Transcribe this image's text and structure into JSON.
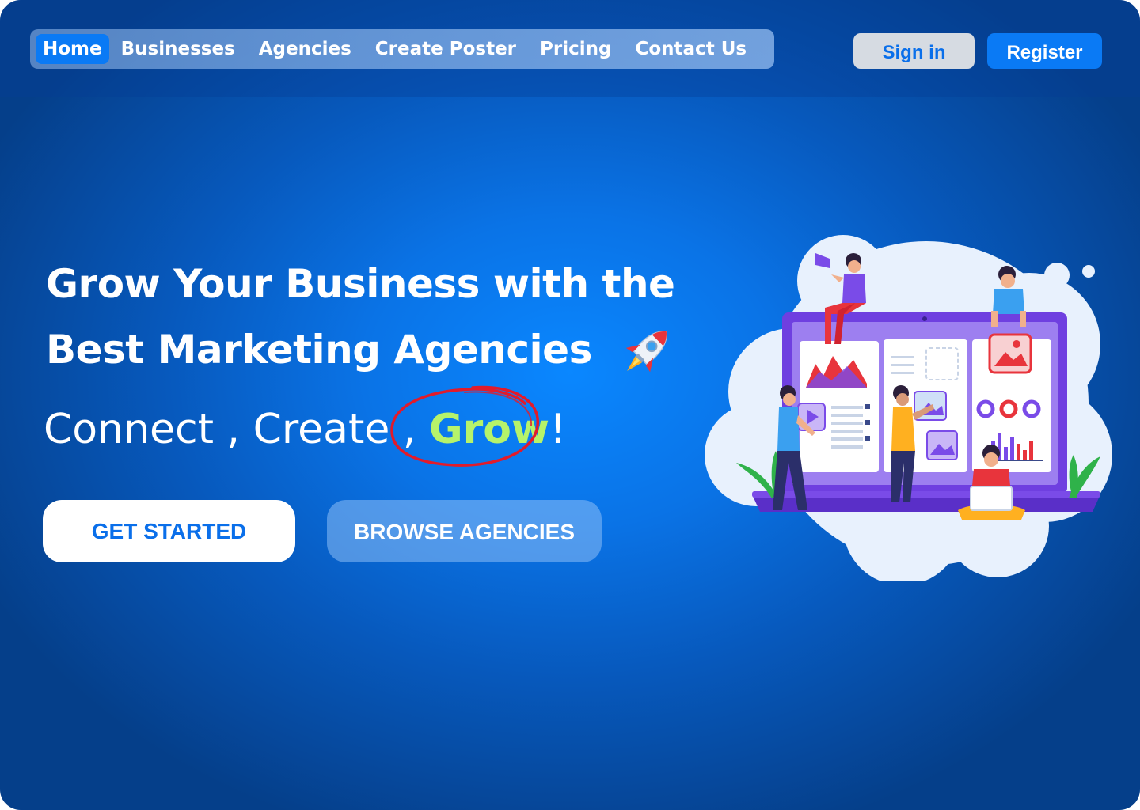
{
  "nav": {
    "items": [
      {
        "label": "Home",
        "active": true
      },
      {
        "label": "Businesses",
        "active": false
      },
      {
        "label": "Agencies",
        "active": false
      },
      {
        "label": "Create Poster",
        "active": false
      },
      {
        "label": "Pricing",
        "active": false
      },
      {
        "label": "Contact Us",
        "active": false
      }
    ],
    "sign_in_label": "Sign in",
    "register_label": "Register"
  },
  "hero": {
    "headline_line1": "Grow Your Business with the",
    "headline_line2": "Best Marketing Agencies",
    "headline_icon": "rocket-icon",
    "tagline_prefix": "Connect , Create , ",
    "tagline_highlight": "Grow",
    "tagline_suffix": "!",
    "primary_cta": "GET STARTED",
    "secondary_cta": "BROWSE AGENCIES",
    "illustration": "marketing-team-illustration"
  },
  "colors": {
    "accent_blue": "#0a7af5",
    "highlight_green": "#b6f36a",
    "circle_red": "#e21b2b",
    "illustration_purple": "#7a4be8"
  }
}
